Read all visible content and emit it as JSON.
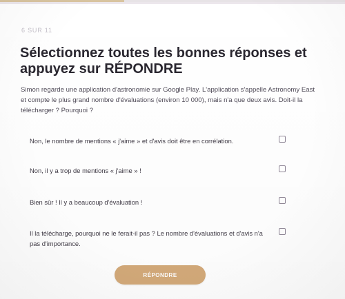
{
  "progress": {
    "counter": "6 SUR 11",
    "fraction": 0.36
  },
  "question": {
    "title": "Sélectionnez toutes les bonnes réponses et appuyez sur RÉPONDRE",
    "prompt": "Simon regarde une application d'astronomie sur Google Play. L'application s'appelle Astronomy East et compte le plus grand nombre d'évaluations (environ 10 000), mais n'a que deux avis. Doit-il la télécharger ? Pourquoi ?"
  },
  "options": [
    {
      "label": "Non, le nombre de mentions « j'aime » et d'avis doit être en corrélation.",
      "checked": false
    },
    {
      "label": "Non, il y a trop de mentions « j'aime » !",
      "checked": false
    },
    {
      "label": "Bien sûr ! Il y a beaucoup d'évaluation !",
      "checked": false
    },
    {
      "label": "Il la télécharge, pourquoi ne le ferait-il pas ? Le nombre d'évaluations et d'avis n'a pas d'importance.",
      "checked": false
    }
  ],
  "submit": {
    "label": "RÉPONDRE"
  },
  "colors": {
    "title": "#2a2730",
    "text": "#3f3a45",
    "counter": "#c2bec7",
    "checkbox_border": "#8f8696",
    "button": "#d4aa7a",
    "progress_fill": "#d8c4a0"
  }
}
